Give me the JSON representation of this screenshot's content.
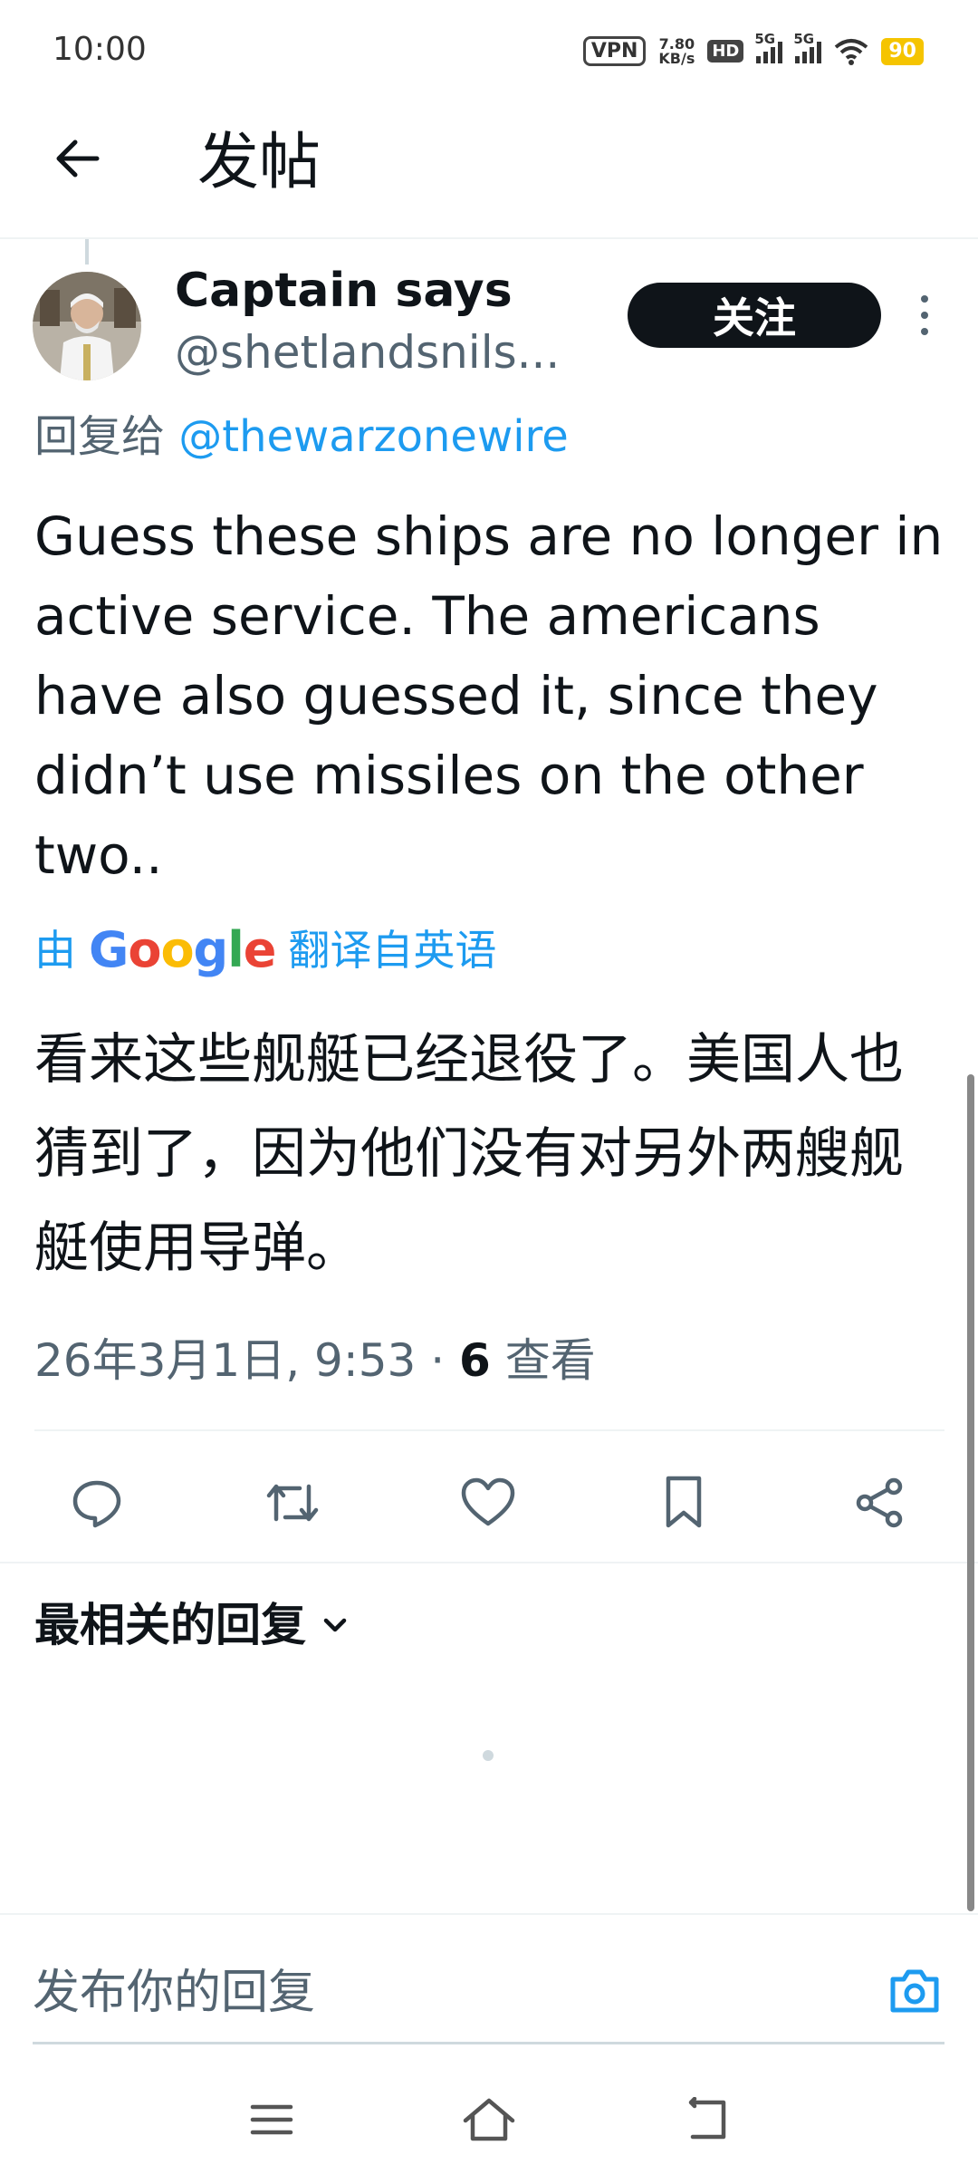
{
  "status_bar": {
    "time": "10:00",
    "vpn": "VPN",
    "speed_value": "7.80",
    "speed_unit": "KB/s",
    "hd": "HD",
    "network1": "5G",
    "network2": "5G",
    "battery": "90"
  },
  "header": {
    "title": "发帖",
    "back_icon": "arrow-left-icon"
  },
  "author": {
    "name": "Captain says",
    "handle": "@shetlandsnils...",
    "follow_label": "关注"
  },
  "reply_to": {
    "prefix": "回复给 ",
    "mention": "@thewarzonewire"
  },
  "tweet_text": "Guess these ships are no longer in active service. The americans have also guessed it, since they didn’t use missiles on the other two..",
  "translation": {
    "by_prefix": "由",
    "provider": "Google",
    "suffix": "翻译自英语",
    "text": "看来这些舰艇已经退役了。美国人也猜到了，因为他们没有对另外两艘舰艇使用导弹。"
  },
  "meta": {
    "timestamp": "26年3月1日, 9:53 · ",
    "views_count": "6",
    "views_label": " 查看"
  },
  "actions": [
    "reply-icon",
    "retweet-icon",
    "like-icon",
    "bookmark-icon",
    "share-icon"
  ],
  "replies": {
    "sort_label": "最相关的回复"
  },
  "reply_box": {
    "placeholder": "发布你的回复"
  },
  "colors": {
    "accent": "#1d9bf0",
    "text": "#0f1419",
    "secondary": "#536471",
    "battery": "#f5c400"
  }
}
